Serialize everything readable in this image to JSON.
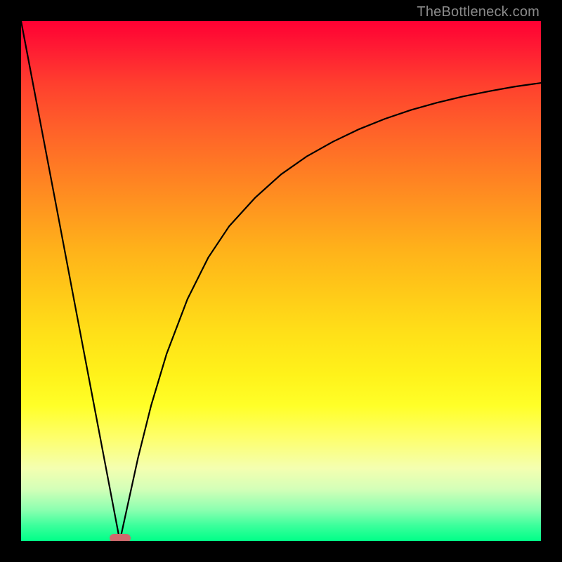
{
  "watermark": "TheBottleneck.com",
  "chart_data": {
    "type": "line",
    "title": "",
    "xlabel": "",
    "ylabel": "",
    "xlim": [
      0,
      100
    ],
    "ylim": [
      0,
      100
    ],
    "grid": false,
    "legend": false,
    "series": [
      {
        "name": "left-descent",
        "x": [
          0.0,
          3.5,
          7.0,
          10.5,
          14.0,
          17.5,
          19.0
        ],
        "values": [
          100.0,
          81.6,
          63.2,
          44.7,
          26.3,
          7.9,
          0.0
        ]
      },
      {
        "name": "right-curve",
        "x": [
          19.0,
          22.5,
          25.0,
          28.0,
          32.0,
          36.0,
          40.0,
          45.0,
          50.0,
          55.0,
          60.0,
          65.0,
          70.0,
          75.0,
          80.0,
          85.0,
          90.0,
          95.0,
          100.0
        ],
        "values": [
          0.0,
          16.0,
          26.0,
          36.0,
          46.5,
          54.5,
          60.5,
          66.0,
          70.5,
          74.0,
          76.8,
          79.2,
          81.2,
          82.9,
          84.3,
          85.5,
          86.5,
          87.4,
          88.1
        ]
      }
    ],
    "marker": {
      "name": "bottleneck-region",
      "x_center": 19.0,
      "y": 0.0,
      "color": "#cf6a6d",
      "shape": "rounded-rect"
    },
    "background_gradient": {
      "direction": "top-to-bottom",
      "stops": [
        {
          "pct": 0,
          "color": "#ff0033"
        },
        {
          "pct": 50,
          "color": "#ffcc18"
        },
        {
          "pct": 75,
          "color": "#ffff3a"
        },
        {
          "pct": 100,
          "color": "#00ff88"
        }
      ]
    }
  }
}
